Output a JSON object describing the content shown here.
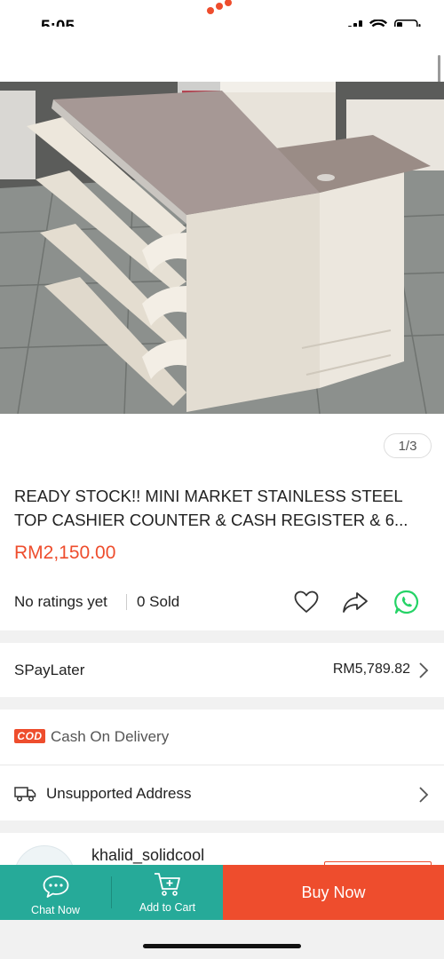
{
  "status_bar": {
    "time": "5:05",
    "icons": [
      "signal-icon",
      "wifi-icon",
      "battery-icon"
    ]
  },
  "product": {
    "image_counter": "1/3",
    "title": "READY STOCK!! MINI MARKET STAINLESS STEEL TOP CASHIER COUNTER & CASH REGISTER & 6...",
    "price": "RM2,150.00",
    "ratings": "No ratings yet",
    "sold": "0 Sold",
    "actions": [
      "heart-icon",
      "share-icon",
      "whatsapp-icon"
    ]
  },
  "spaylater": {
    "label": "SPayLater",
    "value": "RM5,789.82"
  },
  "delivery": {
    "cod_badge": "COD",
    "cod_label": "Cash On Delivery",
    "address_label": "Unsupported Address"
  },
  "seller": {
    "name": "khalid_solidcool"
  },
  "bottom_bar": {
    "chat_label": "Chat Now",
    "cart_label": "Add to Cart",
    "buy_label": "Buy Now"
  },
  "colors": {
    "brand_orange": "#ee4d2d",
    "teal": "#26aa99",
    "whatsapp_green": "#25d366"
  }
}
